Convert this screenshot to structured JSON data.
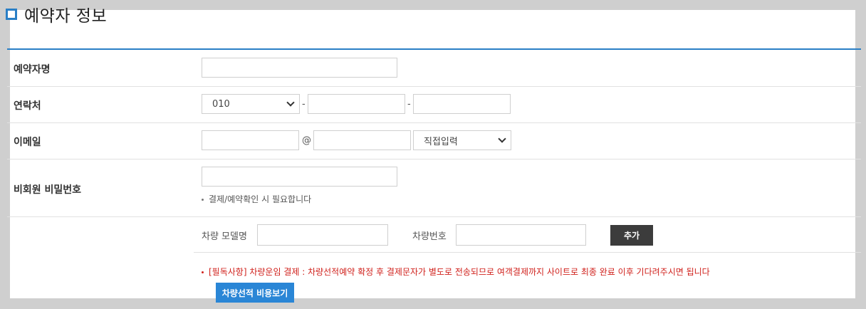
{
  "section": {
    "title": "예약자 정보"
  },
  "rows": {
    "name": {
      "label": "예약자명"
    },
    "phone": {
      "label": "연락처",
      "prefix": "010",
      "sep1": "-",
      "sep2": "-"
    },
    "email": {
      "label": "이메일",
      "at": "@",
      "domain_select": "직접입력"
    },
    "password": {
      "label": "비회원 비밀번호",
      "note": "결제/예약확인 시 필요합니다"
    }
  },
  "car": {
    "model_label": "차량 모델명",
    "number_label": "차량번호",
    "add_button": "추가",
    "notice": "[필독사항] 차량운임 결제 : 차량선적예약 확정 후 결제문자가 별도로 전송되므로 여객결제까지 사이트로 최종 완료 이후 기다려주시면 됩니다",
    "view_cost_button": "차량선적 비용보기"
  },
  "colors": {
    "accent": "#2a7fc6",
    "warning": "#d0211c",
    "dark_button": "#3c3c3c",
    "blue_button": "#2a86d6"
  }
}
